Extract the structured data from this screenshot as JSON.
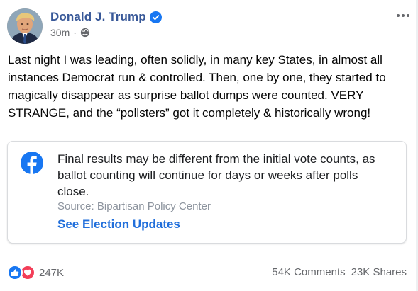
{
  "post": {
    "author": "Donald J. Trump",
    "time": "30m",
    "separator": "·",
    "audience_icon": "globe-icon",
    "more_icon": "ellipsis-icon",
    "text": "Last night I was leading, often solidly, in many key States, in almost all instances Democrat run & controlled. Then, one by one, they started to magically disappear as surprise ballot dumps were counted. VERY STRANGE, and the “pollsters” got it completely & historically wrong!"
  },
  "notice": {
    "icon": "facebook-logo-icon",
    "text": "Final results may be different from the initial vote counts, as ballot counting will continue for days or weeks after polls close.",
    "source": "Source: Bipartisan Policy Center",
    "link": "See Election Updates"
  },
  "footer": {
    "reaction_icons": [
      "like-icon",
      "love-icon"
    ],
    "reaction_count": "247K",
    "comments": "54K Comments",
    "shares": "23K Shares"
  },
  "colors": {
    "author_name": "#385898",
    "verified_badge": "#1877f2",
    "link": "#216fdb",
    "meta_text": "#65676b",
    "like": "#1877f2",
    "love": "#f33e58"
  }
}
